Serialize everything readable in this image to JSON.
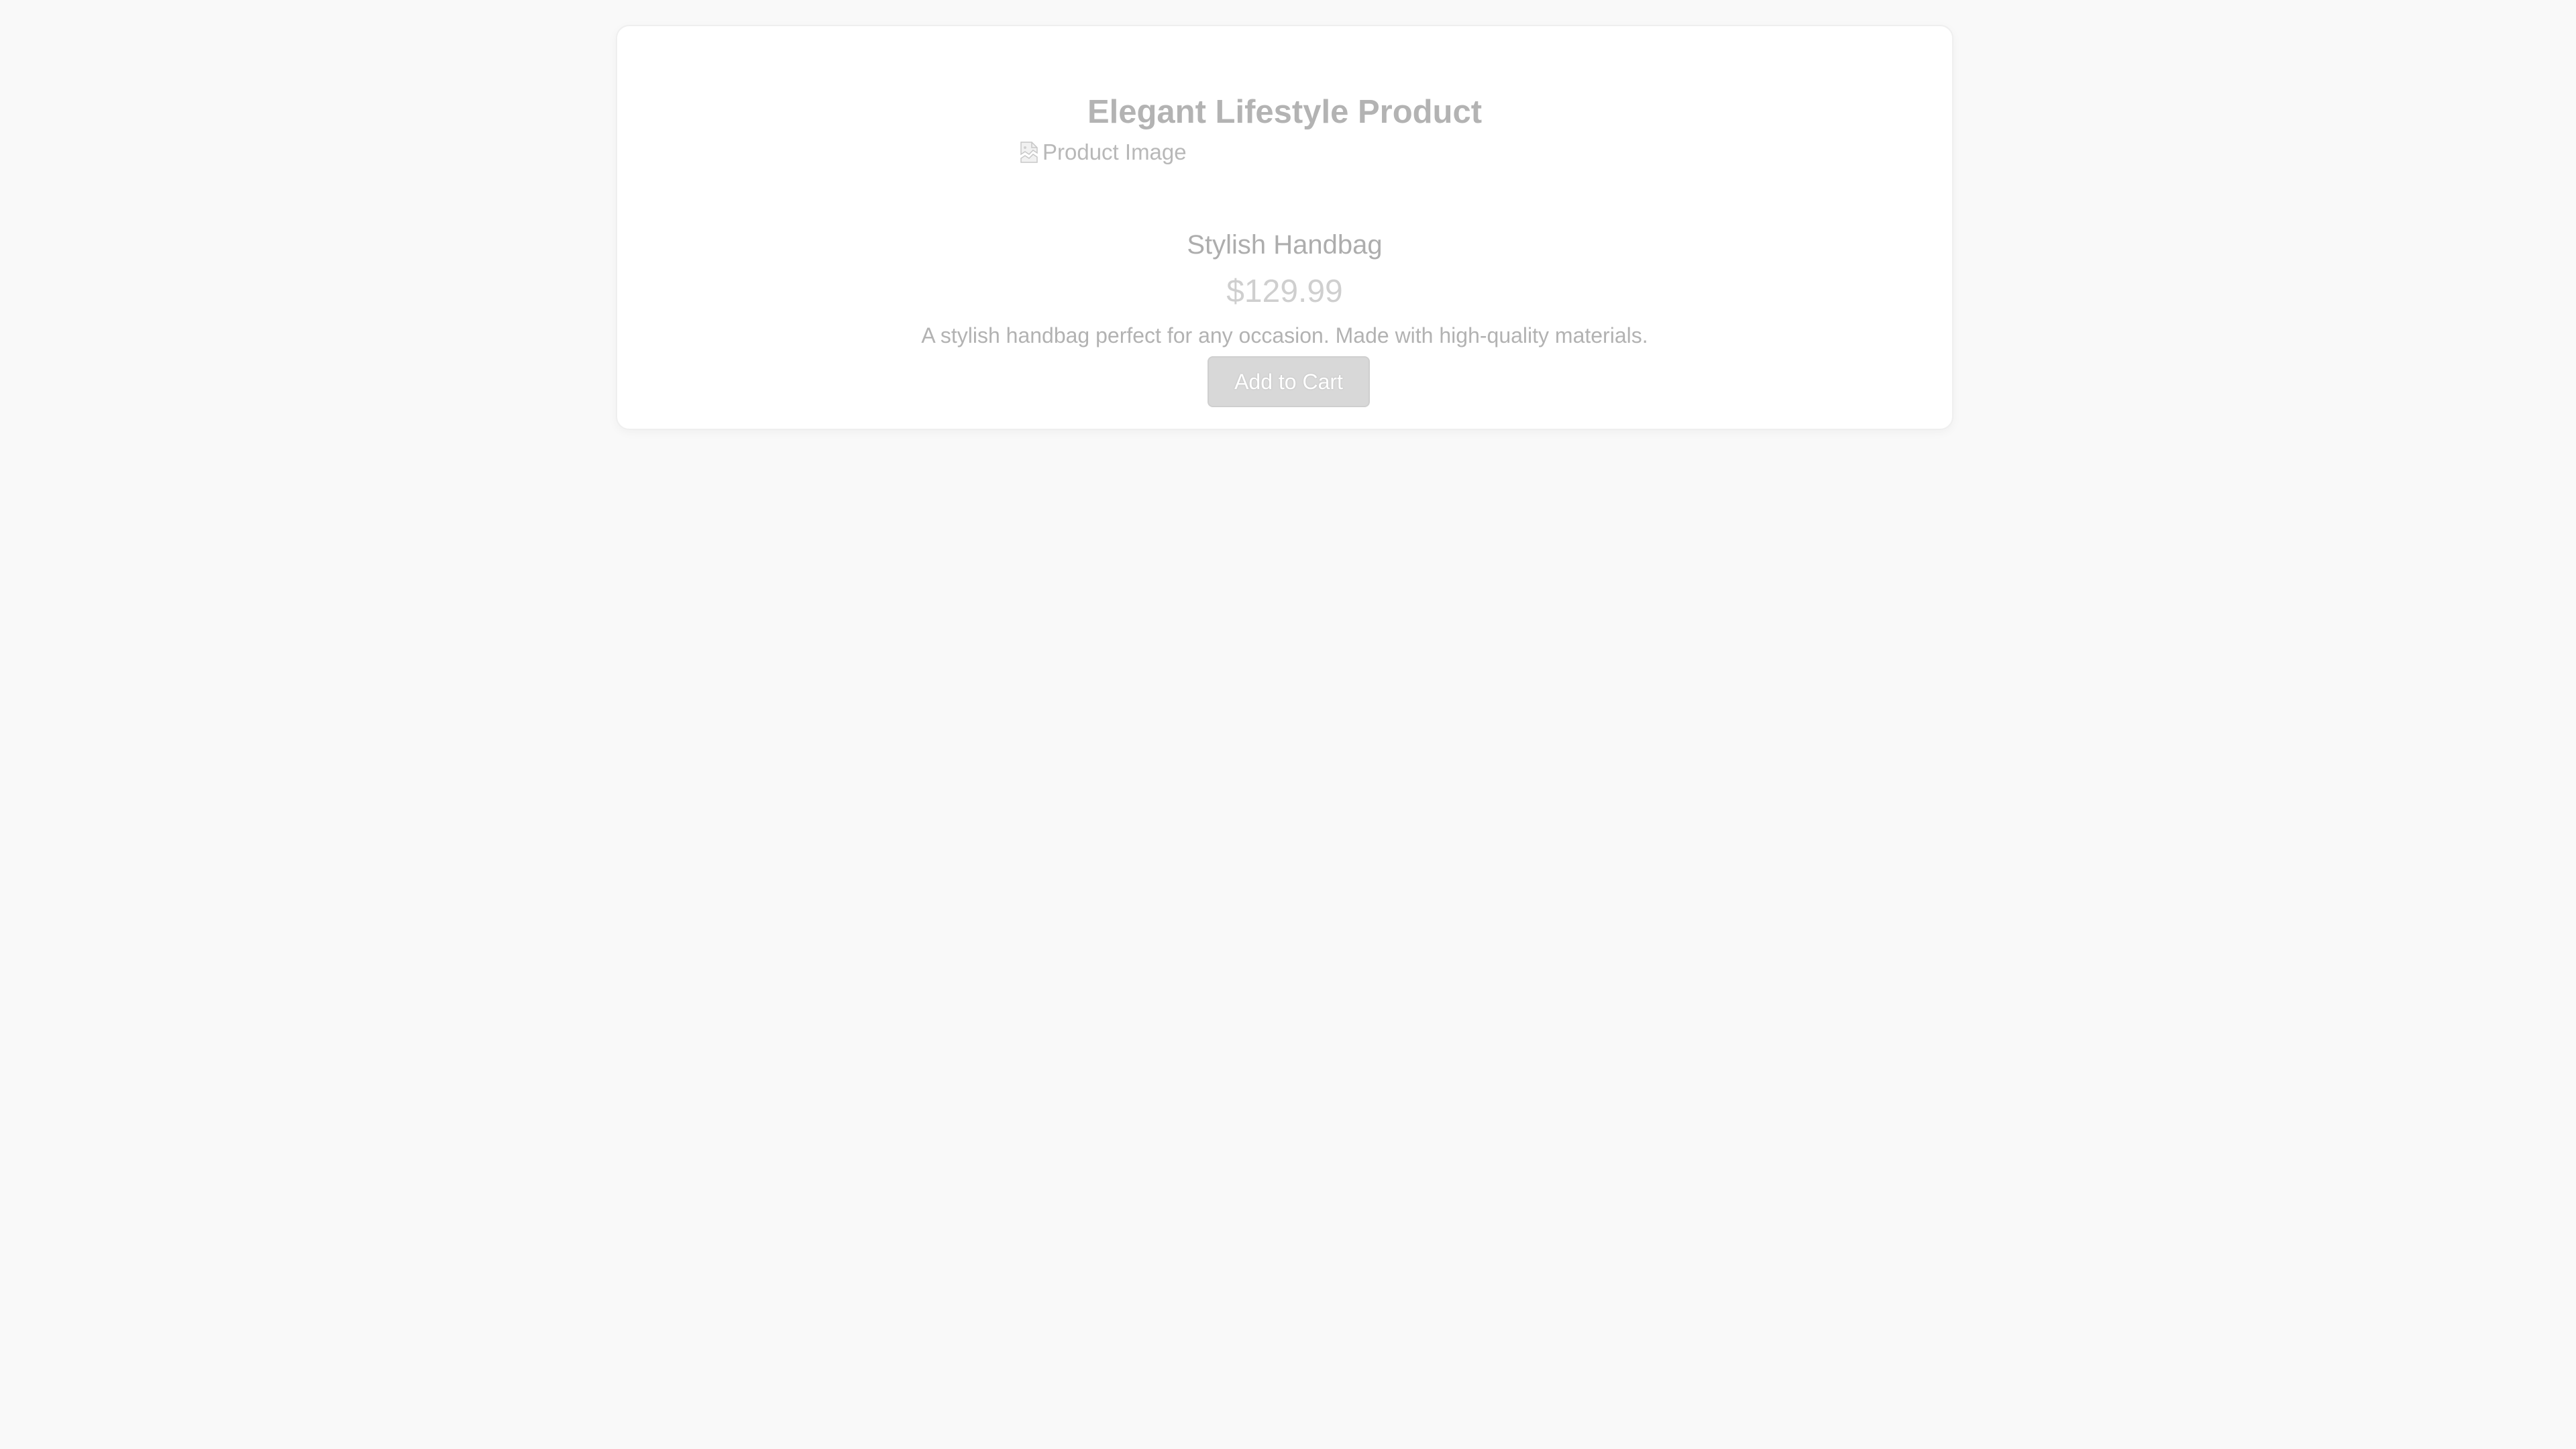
{
  "product": {
    "page_title": "Elegant Lifestyle Product",
    "image_alt": "Product Image",
    "name": "Stylish Handbag",
    "price": "$129.99",
    "description": "A stylish handbag perfect for any occasion. Made with high-quality materials.",
    "cta_label": "Add to Cart"
  },
  "icons": {
    "broken_image": "broken-image-icon"
  },
  "colors": {
    "page_background": "#f9f9f9",
    "card_background": "#ffffff",
    "button_background": "#d8d8d8",
    "muted_text": "#b3b3b3"
  }
}
